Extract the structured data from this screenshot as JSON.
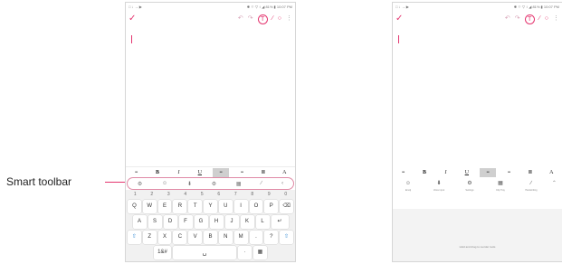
{
  "callout": {
    "label": "Smart toolbar"
  },
  "status_left": "□ ↓ → ▶",
  "status_right": "✱ ⚐ ▽ ↕ ◢ 81% ▮ 10:07 PM",
  "editor_toolbar": {
    "check": "✓",
    "undo": "↶",
    "redo": "↷",
    "text": "T",
    "pen": "∕",
    "lasso": "○",
    "more": "⋮"
  },
  "format_bar": [
    "≡",
    "B",
    "I",
    "U",
    "≡",
    "≡",
    "≣",
    "A"
  ],
  "smart_toolbar": [
    "⚙",
    "☺",
    "⬇",
    "⚙",
    "▦",
    "∕",
    "‹"
  ],
  "keyboard": {
    "numbers": [
      "1",
      "2",
      "3",
      "4",
      "5",
      "6",
      "7",
      "8",
      "9",
      "0"
    ],
    "row1": [
      "Q",
      "W",
      "E",
      "R",
      "T",
      "Y",
      "U",
      "I",
      "O",
      "P",
      "⌫"
    ],
    "row2": [
      "A",
      "S",
      "D",
      "F",
      "G",
      "H",
      "J",
      "K",
      "L",
      "↵"
    ],
    "row3": [
      "⇧",
      "Z",
      "X",
      "C",
      "V",
      "B",
      "N",
      "M",
      ".",
      "?",
      "⇧"
    ],
    "row4": [
      "1&#",
      "␣",
      "·",
      "▦"
    ]
  },
  "expanded_toolbar": [
    {
      "icon": "☺",
      "label": "Emoji"
    },
    {
      "icon": "⬇",
      "label": "Voice input"
    },
    {
      "icon": "⚙",
      "label": "Settings"
    },
    {
      "icon": "▦",
      "label": "Clip Tray"
    },
    {
      "icon": "∕",
      "label": "Handwriting"
    }
  ],
  "expanded_chevron": "⌃",
  "tray_hint": "Hold and drag to reorder tools"
}
